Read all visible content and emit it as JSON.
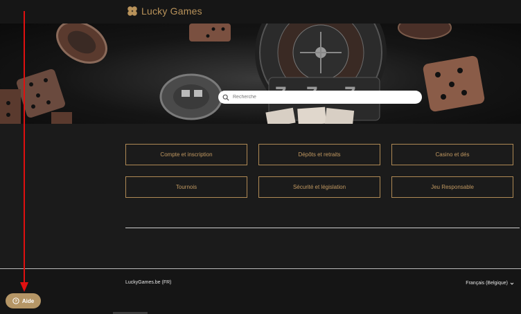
{
  "header": {
    "logo_text": "Lucky Games"
  },
  "hero": {
    "search_placeholder": "Recherche"
  },
  "categories": [
    {
      "label": "Compte et inscription"
    },
    {
      "label": "Dépôts et retraits"
    },
    {
      "label": "Casino et dés"
    },
    {
      "label": "Tournois"
    },
    {
      "label": "Sécurité et législation"
    },
    {
      "label": "Jeu Responsable"
    }
  ],
  "footer": {
    "site": "LuckyGames.be (FR)",
    "language": "Français (Belgique)"
  },
  "help": {
    "label": "Aide"
  },
  "colors": {
    "accent": "#b59666",
    "arrow": "#e01010",
    "background": "#1b1b1b"
  },
  "icons": {
    "logo": "clover-icon",
    "search": "search-icon",
    "help": "question-circle-icon",
    "language": "chevron-down-icon"
  }
}
